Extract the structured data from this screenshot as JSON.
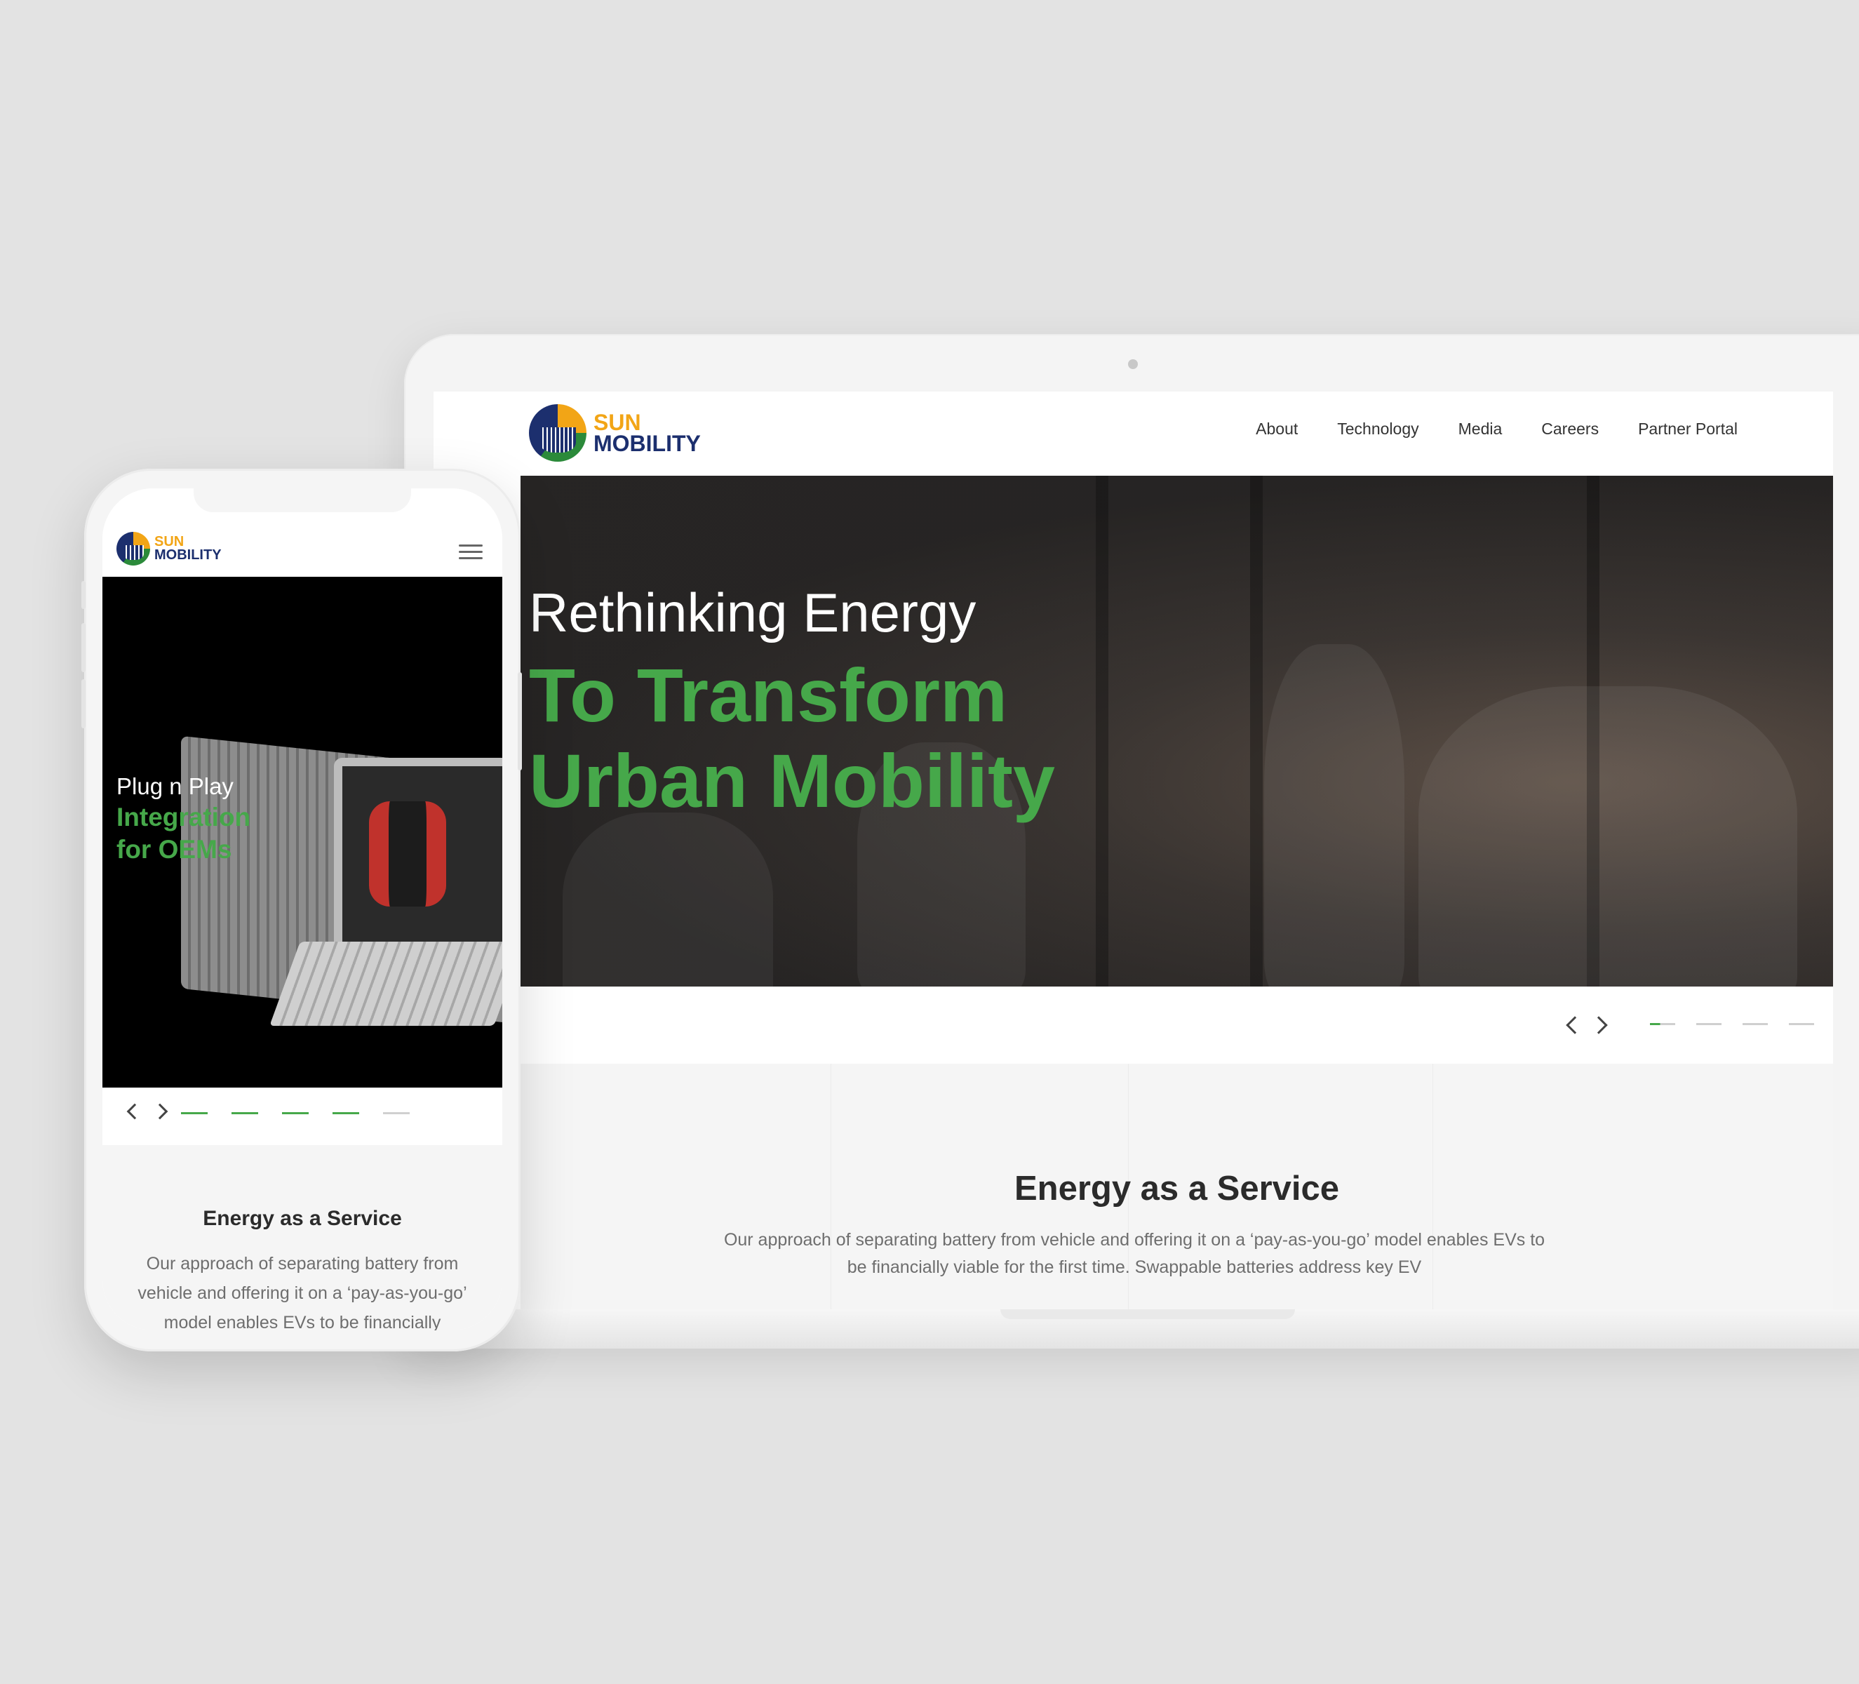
{
  "brand": {
    "logo_line1": "SUN",
    "logo_line2": "MOBILITY",
    "colors": {
      "green": "#46a84a",
      "orange": "#f2a516",
      "navy": "#1c2f6e"
    }
  },
  "desktop": {
    "nav": [
      "About",
      "Technology",
      "Media",
      "Careers",
      "Partner Portal"
    ],
    "hero": {
      "line1": "Rethinking Energy",
      "line2": "To Transform",
      "line3": "Urban Mobility"
    },
    "slider": {
      "total": 5,
      "active": 1,
      "prev_icon": "chevron-left-icon",
      "next_icon": "chevron-right-icon"
    },
    "section": {
      "title": "Energy as a Service",
      "body": "Our approach of separating battery from vehicle and offering it on a ‘pay-as-you-go’ model enables EVs to be financially viable for the first time. Swappable batteries address key EV"
    }
  },
  "mobile": {
    "menu_icon": "hamburger-menu-icon",
    "hero": {
      "line1": "Plug n Play",
      "line2": "Integration",
      "line3": "for OEMs"
    },
    "slider": {
      "total": 5,
      "active": 4
    },
    "section": {
      "title": "Energy as a Service",
      "body": "Our approach of separating battery from vehicle and offering it on a ‘pay-as-you-go’ model enables EVs to be financially"
    }
  }
}
